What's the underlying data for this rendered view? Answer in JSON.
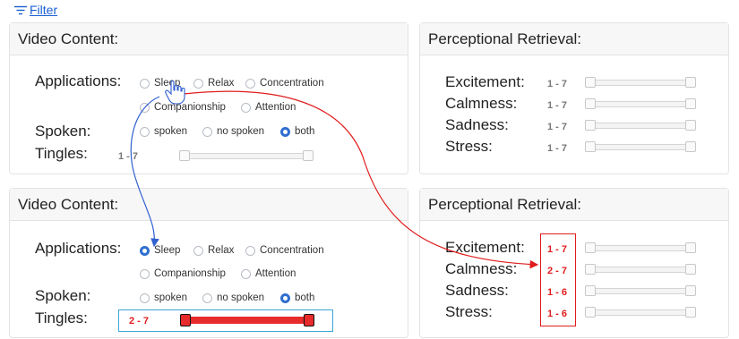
{
  "filter": {
    "label": "Filter"
  },
  "panels": {
    "top_left": {
      "title": "Video Content:"
    },
    "top_right": {
      "title": "Perceptional Retrieval:"
    },
    "bottom_left": {
      "title": "Video Content:"
    },
    "bottom_right": {
      "title": "Perceptional Retrieval:"
    }
  },
  "video_content": {
    "applications_label": "Applications:",
    "spoken_label": "Spoken:",
    "tingles_label": "Tingles:",
    "applications": [
      "Sleep",
      "Relax",
      "Concentration",
      "Companionship",
      "Attention"
    ],
    "spoken_options": [
      "spoken",
      "no spoken",
      "both"
    ]
  },
  "top_state": {
    "selected_application": null,
    "selected_spoken": "both",
    "tingles_range": "1 - 7",
    "tingles_value": {
      "min": 1,
      "max": 7
    }
  },
  "bottom_state": {
    "selected_application": "Sleep",
    "selected_spoken": "both",
    "tingles_range": "2 - 7",
    "tingles_value": {
      "min": 2,
      "max": 7
    }
  },
  "perceptional": {
    "labels": [
      "Excitement:",
      "Calmness:",
      "Sadness:",
      "Stress:"
    ],
    "top_ranges": [
      "1 - 7",
      "1 - 7",
      "1 - 7",
      "1 - 7"
    ],
    "bottom_ranges": [
      "1 - 7",
      "2 - 7",
      "1 - 6",
      "1 - 6"
    ]
  },
  "colors": {
    "accent_blue": "#2f6fd0",
    "highlight_red": "#e01c1c",
    "highlight_blue_box": "#3ba7d8"
  },
  "icons": {
    "filter": "filter-lines-icon",
    "cursor": "hand-pointer-icon"
  }
}
